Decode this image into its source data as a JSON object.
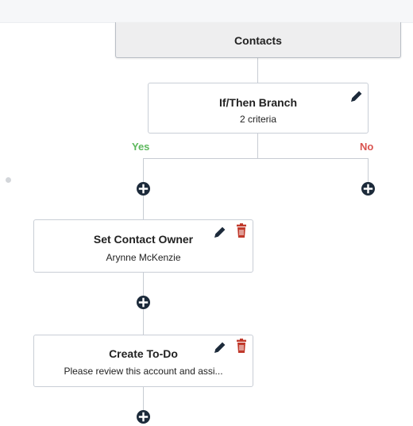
{
  "trigger": {
    "title": "Contacts"
  },
  "branch": {
    "title": "If/Then Branch",
    "subtitle": "2 criteria",
    "yes_label": "Yes",
    "no_label": "No"
  },
  "steps": [
    {
      "title": "Set Contact Owner",
      "subtitle": "Arynne McKenzie"
    },
    {
      "title": "Create To-Do",
      "subtitle": "Please review this account and assi..."
    }
  ],
  "icons": {
    "edit": "pencil-icon",
    "delete": "trash-icon",
    "add": "plus-circle-icon"
  },
  "colors": {
    "yes": "#5cb85c",
    "no": "#d9534f",
    "add_button": "#1c2a3a",
    "delete": "#c0392b",
    "edit": "#1c2a3a"
  }
}
